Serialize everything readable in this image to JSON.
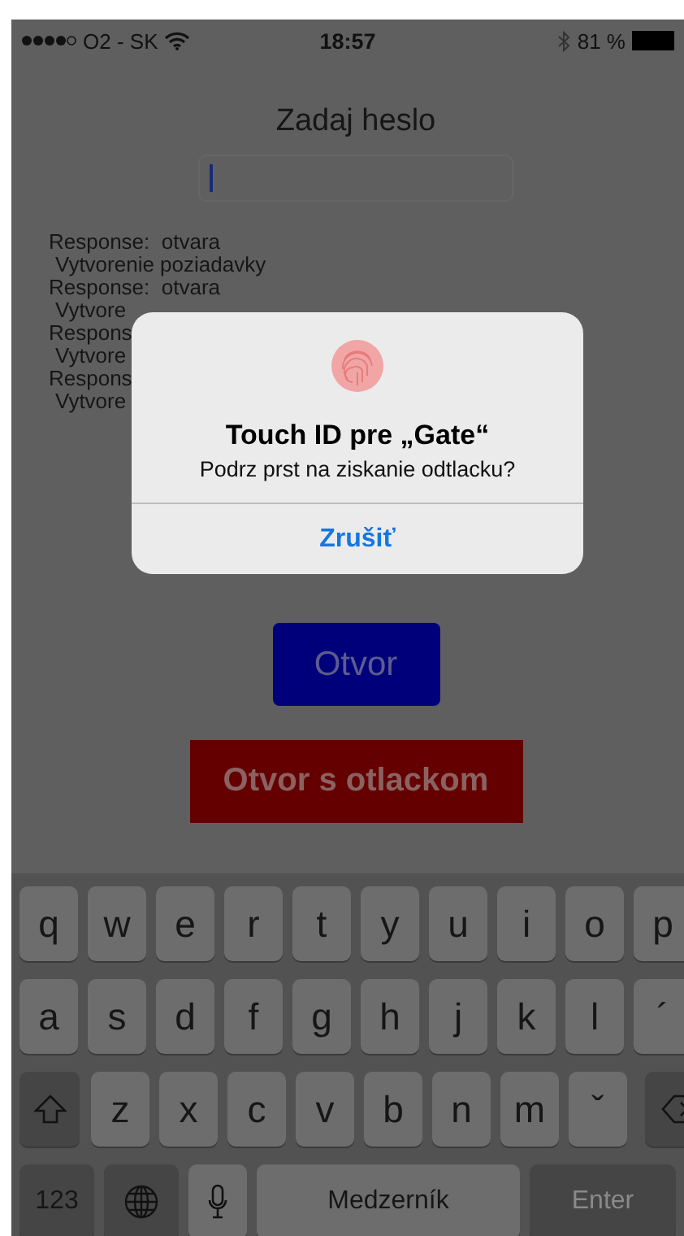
{
  "status_bar": {
    "carrier": "O2 - SK",
    "time": "18:57",
    "battery": "81 %"
  },
  "prompt": "Zadaj heslo",
  "password_field": {
    "focused": true
  },
  "log": [
    {
      "kind": "response",
      "text": "Response:  otvara"
    },
    {
      "kind": "request",
      "text": "Vytvorenie poziadavky"
    },
    {
      "kind": "response",
      "text": "Response:  otvara"
    },
    {
      "kind": "request",
      "text": "Vytvore"
    },
    {
      "kind": "response",
      "text": "Respons"
    },
    {
      "kind": "request",
      "text": "Vytvore"
    },
    {
      "kind": "response",
      "text": "Respons"
    },
    {
      "kind": "request",
      "text": "Vytvore"
    }
  ],
  "buttons": [
    {
      "kind": "open",
      "label": "Otvor"
    },
    {
      "kind": "fingerprint",
      "label": "Otvor s otlackom"
    }
  ],
  "dialog": {
    "title": "Touch ID pre „Gate“",
    "message": "Podrz prst na ziskanie odtlacku?",
    "action": "Zrušiť"
  },
  "keyboard": {
    "top_letters": [
      "q",
      "w",
      "e",
      "r",
      "t",
      "y",
      "u",
      "i",
      "o",
      "p"
    ],
    "middle_letters": [
      "a",
      "s",
      "d",
      "f",
      "g",
      "h",
      "j",
      "k",
      "l",
      "´"
    ],
    "bottom_letters": [
      "z",
      "x",
      "c",
      "v",
      "b",
      "n",
      "m",
      "ˇ"
    ],
    "numbers_key": "123",
    "space_key": "Medzerník",
    "enter_key": {
      "label": "Enter",
      "disabled": true
    }
  }
}
